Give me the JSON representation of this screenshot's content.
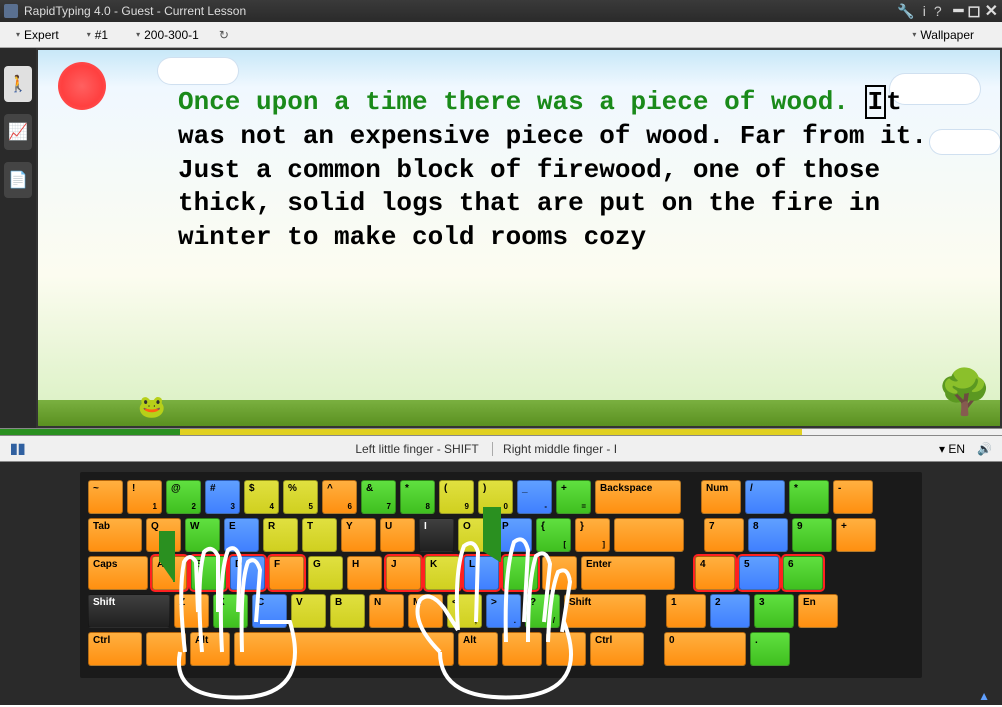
{
  "title": "RapidTyping 4.0 - Guest - Current Lesson",
  "toolbar": {
    "level": "Expert",
    "lesson": "#1",
    "sublesson": "200-300-1",
    "wallpaper": "Wallpaper"
  },
  "lesson_text": {
    "typed": "Once upon a time there was a piece of wood. ",
    "cursor": "I",
    "remaining": "t was not an expensive piece of wood. Far from it. Just a common block of firewood, one of those thick, solid logs that are put on the fire in winter to make cold rooms cozy"
  },
  "hints": {
    "left": "Left little finger - SHIFT",
    "right": "Right middle finger - I"
  },
  "lang": "EN",
  "keys": {
    "row1": [
      {
        "t": "~",
        "c": "c-or",
        "w": "w35"
      },
      {
        "t": "!",
        "s": "1",
        "c": "c-or",
        "w": "w35"
      },
      {
        "t": "@",
        "s": "2",
        "c": "c-gr",
        "w": "w35"
      },
      {
        "t": "#",
        "s": "3",
        "c": "c-bl",
        "w": "w35"
      },
      {
        "t": "$",
        "s": "4",
        "c": "c-ye",
        "w": "w35"
      },
      {
        "t": "%",
        "s": "5",
        "c": "c-ye",
        "w": "w35"
      },
      {
        "t": "^",
        "s": "6",
        "c": "c-or",
        "w": "w35"
      },
      {
        "t": "&",
        "s": "7",
        "c": "c-gr",
        "w": "w35"
      },
      {
        "t": "*",
        "s": "8",
        "c": "c-gr",
        "w": "w35"
      },
      {
        "t": "(",
        "s": "9",
        "c": "c-ye",
        "w": "w35"
      },
      {
        "t": ")",
        "s": "0",
        "c": "c-ye",
        "w": "w35"
      },
      {
        "t": "_",
        "s": "-",
        "c": "c-bl",
        "w": "w35"
      },
      {
        "t": "+",
        "s": "=",
        "c": "c-gr",
        "w": "w35"
      },
      {
        "t": "Backspace",
        "c": "c-or",
        "w": "w86"
      }
    ],
    "row1b": [
      {
        "t": "Num",
        "c": "c-or",
        "w": "w40"
      },
      {
        "t": "/",
        "c": "c-bl",
        "w": "w40"
      },
      {
        "t": "*",
        "c": "c-gr",
        "w": "w40"
      },
      {
        "t": "-",
        "c": "c-or",
        "w": "w40"
      }
    ],
    "row2": [
      {
        "t": "Tab",
        "c": "c-or",
        "w": "w54"
      },
      {
        "t": "Q",
        "c": "c-or",
        "w": "w35"
      },
      {
        "t": "W",
        "c": "c-gr",
        "w": "w35"
      },
      {
        "t": "E",
        "c": "c-bl",
        "w": "w35"
      },
      {
        "t": "R",
        "c": "c-ye",
        "w": "w35"
      },
      {
        "t": "T",
        "c": "c-ye",
        "w": "w35"
      },
      {
        "t": "Y",
        "c": "c-or",
        "w": "w35"
      },
      {
        "t": "U",
        "c": "c-or",
        "w": "w35"
      },
      {
        "t": "I",
        "c": "c-bk",
        "w": "w35"
      },
      {
        "t": "O",
        "c": "c-ye",
        "w": "w35"
      },
      {
        "t": "P",
        "c": "c-bl",
        "w": "w35"
      },
      {
        "t": "{",
        "s": "[",
        "c": "c-gr",
        "w": "w35"
      },
      {
        "t": "}",
        "s": "]",
        "c": "c-or",
        "w": "w35"
      },
      {
        "t": "",
        "c": "c-or",
        "w": "w70"
      }
    ],
    "row2b": [
      {
        "t": "7",
        "c": "c-or",
        "w": "w40"
      },
      {
        "t": "8",
        "c": "c-bl",
        "w": "w40"
      },
      {
        "t": "9",
        "c": "c-gr",
        "w": "w40"
      },
      {
        "t": "+",
        "c": "c-or",
        "w": "w40"
      }
    ],
    "row3": [
      {
        "t": "Caps",
        "c": "c-or",
        "w": "w60"
      },
      {
        "t": "A",
        "c": "c-or",
        "w": "w35",
        "hl": true
      },
      {
        "t": "S",
        "c": "c-gr",
        "w": "w35",
        "hl": true
      },
      {
        "t": "D",
        "c": "c-bl",
        "w": "w35",
        "hl": true
      },
      {
        "t": "F",
        "c": "c-or",
        "w": "w35",
        "hl": true
      },
      {
        "t": "G",
        "c": "c-ye",
        "w": "w35"
      },
      {
        "t": "H",
        "c": "c-or",
        "w": "w35"
      },
      {
        "t": "J",
        "c": "c-or",
        "w": "w35",
        "hl": true
      },
      {
        "t": "K",
        "c": "c-ye",
        "w": "w35",
        "hl": true
      },
      {
        "t": "L",
        "c": "c-bl",
        "w": "w35",
        "hl": true
      },
      {
        "t": ":",
        "s": ";",
        "c": "c-gr",
        "w": "w35",
        "hl": true
      },
      {
        "t": "\"",
        "s": "'",
        "c": "c-or",
        "w": "w35"
      },
      {
        "t": "Enter",
        "c": "c-or",
        "w": "w94"
      }
    ],
    "row3b": [
      {
        "t": "4",
        "c": "c-or",
        "w": "w40",
        "hl": true
      },
      {
        "t": "5",
        "c": "c-bl",
        "w": "w40",
        "hl": true
      },
      {
        "t": "6",
        "c": "c-gr",
        "w": "w40",
        "hl": true
      }
    ],
    "row4": [
      {
        "t": "Shift",
        "c": "c-bk",
        "w": "w82"
      },
      {
        "t": "Z",
        "c": "c-or",
        "w": "w35"
      },
      {
        "t": "X",
        "c": "c-gr",
        "w": "w35"
      },
      {
        "t": "C",
        "c": "c-bl",
        "w": "w35"
      },
      {
        "t": "V",
        "c": "c-ye",
        "w": "w35"
      },
      {
        "t": "B",
        "c": "c-ye",
        "w": "w35"
      },
      {
        "t": "N",
        "c": "c-or",
        "w": "w35"
      },
      {
        "t": "M",
        "c": "c-or",
        "w": "w35"
      },
      {
        "t": "<",
        "s": ",",
        "c": "c-ye",
        "w": "w35"
      },
      {
        "t": ">",
        "s": ".",
        "c": "c-bl",
        "w": "w35"
      },
      {
        "t": "?",
        "s": "/",
        "c": "c-gr",
        "w": "w35"
      },
      {
        "t": "Shift",
        "c": "c-or",
        "w": "w82"
      }
    ],
    "row4b": [
      {
        "t": "1",
        "c": "c-or",
        "w": "w40"
      },
      {
        "t": "2",
        "c": "c-bl",
        "w": "w40"
      },
      {
        "t": "3",
        "c": "c-gr",
        "w": "w40"
      },
      {
        "t": "En",
        "c": "c-or",
        "w": "w40"
      }
    ],
    "row5": [
      {
        "t": "Ctrl",
        "c": "c-or",
        "w": "w54"
      },
      {
        "t": "",
        "c": "c-or",
        "w": "w40"
      },
      {
        "t": "Alt",
        "c": "c-or",
        "w": "w40"
      },
      {
        "t": "",
        "c": "c-or",
        "w": "w220"
      },
      {
        "t": "Alt",
        "c": "c-or",
        "w": "w40"
      },
      {
        "t": "",
        "c": "c-or",
        "w": "w40"
      },
      {
        "t": "",
        "c": "c-or",
        "w": "w40"
      },
      {
        "t": "Ctrl",
        "c": "c-or",
        "w": "w54"
      }
    ],
    "row5b": [
      {
        "t": "0",
        "c": "c-or",
        "w": "w82"
      },
      {
        "t": ".",
        "c": "c-gr",
        "w": "w40"
      }
    ]
  }
}
